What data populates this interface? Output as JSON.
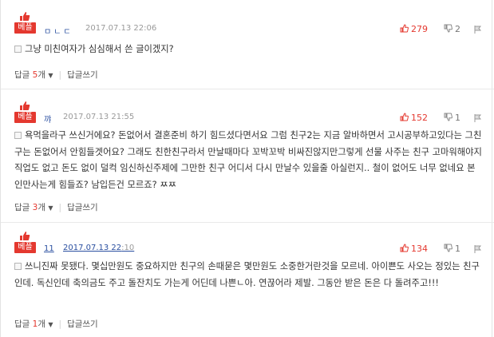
{
  "badge_label": "베플",
  "reply_label": "답글",
  "reply_unit": "개",
  "reply_more": "▼",
  "write_reply": "답글쓰기",
  "icons": {
    "thumb": "thumbs-up-icon",
    "like": "hand-up-icon",
    "dislike": "hand-down-icon",
    "report": "flag-icon",
    "memo": "memo-icon"
  },
  "colors": {
    "accent": "#e4382f",
    "nick": "#2a4fa0",
    "meta": "#9a9a9a"
  },
  "comments": [
    {
      "nick": "ㅁㄴㄷ",
      "date": "2017.07.13 22:06",
      "likes": "279",
      "dislikes": "2",
      "text": "그냥 미친여자가 심심해서 쓴 글이겠지?",
      "reply_count": "5"
    },
    {
      "nick": "꺄",
      "date": "2017.07.13 21:55",
      "likes": "152",
      "dislikes": "1",
      "text": "욕먹을라구 쓰신거에요? 돈없어서 결혼준비 하기 힘드셨다면서요 그럼 친구2는 지금 알바하면서 고시공부하고있다는 그친구는 돈없어서 안힘들겟어요? 그래도 친한친구라서 만날때마다 꼬박꼬박 비싸진않지만그렇게 선물 사주는 친구 고마워해야지 직업도 없고 돈도 없이 덜컥 임신하신주제에 그만한 친구 어디서 다시 만날수 있을줄 아실런지.. 철이 없어도 너무 없네요 본인만사는게 힘들죠? 남입든건 모르죠? ㅉㅉ",
      "reply_count": "3"
    },
    {
      "nick": "11",
      "date_main": "2017.07.13 22",
      "date_tail": ":10",
      "likes": "134",
      "dislikes": "1",
      "text": "쓰니진짜 못됐다. 몇십만원도 중요하지만 친구의 손때묻은 몇만원도 소중한거란것을 모르네. 아이쁜도 사오는 정있는 친구인데. 독신인데 축의금도 주고 돌잔치도 가는게 어딘데 나쁜ㄴ아. 연끊어라 제발. 그동안 받은 돈은 다 돌려주고!!!",
      "reply_count": "1"
    }
  ]
}
